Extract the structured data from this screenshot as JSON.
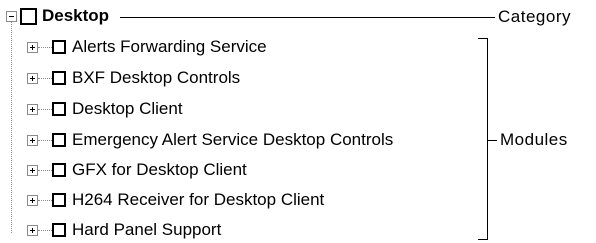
{
  "tree": {
    "category": {
      "label": "Desktop",
      "expanded": true,
      "checked": false
    },
    "modules": [
      {
        "label": "Alerts Forwarding Service",
        "expanded": false,
        "checked": false
      },
      {
        "label": "BXF Desktop Controls",
        "expanded": false,
        "checked": false
      },
      {
        "label": "Desktop Client",
        "expanded": false,
        "checked": false
      },
      {
        "label": "Emergency Alert Service Desktop Controls",
        "expanded": false,
        "checked": false
      },
      {
        "label": "GFX for Desktop Client",
        "expanded": false,
        "checked": false
      },
      {
        "label": "H264 Receiver for Desktop Client",
        "expanded": false,
        "checked": false
      },
      {
        "label": "Hard Panel Support",
        "expanded": false,
        "checked": false
      }
    ]
  },
  "annotations": {
    "category_label": "Category",
    "modules_label": "Modules"
  },
  "icons": {
    "collapse": "minus-box-icon",
    "expand": "plus-box-icon",
    "checkbox": "checkbox-icon"
  },
  "colors": {
    "background": "#ffffff",
    "text": "#000000",
    "tree_lines": "#8a8a8a"
  }
}
